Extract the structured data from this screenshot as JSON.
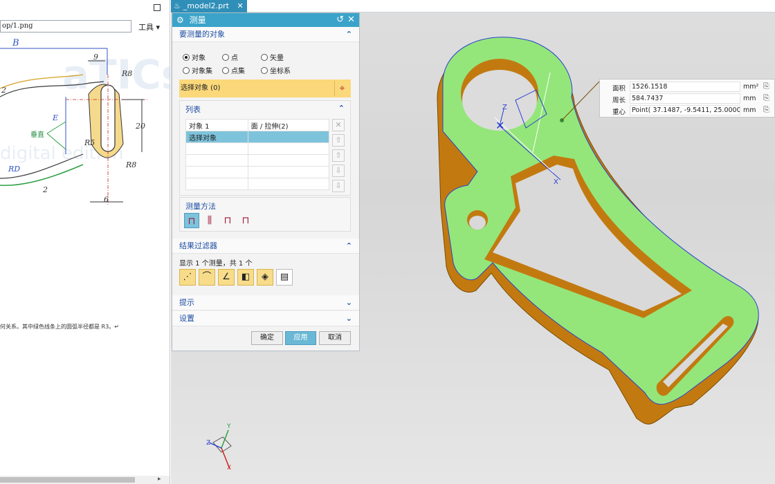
{
  "left_pane": {
    "path": "op/1.png",
    "tools_menu": "工具 ▾",
    "drawing": {
      "label_B": "B",
      "dim_9": "9",
      "dim_R8_top": "R8",
      "dim_20": "20",
      "dim_R8_bottom": "R8",
      "dim_6": "6",
      "label_E": "E",
      "label_perp": "垂直",
      "label_R5": "R5",
      "label_RD": "RD",
      "dim_2": "2",
      "dim_2b": "2",
      "watermark": "digital edition"
    },
    "note": "何关系。其中绿色线条上的圆弧半径都是 R3。↵"
  },
  "file_tab": {
    "icon": "part-icon",
    "label": "_model2.prt",
    "close": "✕"
  },
  "dialog": {
    "title": "测量",
    "title_icon": "gear-icon",
    "reset": "↺",
    "close": "✕",
    "section_objects": "要测量的对象",
    "radio": {
      "object": "对象",
      "point": "点",
      "vector": "矢量",
      "object_set": "对象集",
      "point_set": "点集",
      "csys": "坐标系"
    },
    "select_label": "选择对象 (0)",
    "list_title": "列表",
    "list_rows": [
      {
        "name": "对象 1",
        "type": "面 / 拉伸(2)"
      },
      {
        "name": "选择对象",
        "type": ""
      }
    ],
    "method_title": "测量方法",
    "section_filter": "结果过滤器",
    "filter_count": "显示 1 个测量，共 1 个",
    "section_hint": "提示",
    "section_settings": "设置",
    "btn_ok": "确定",
    "btn_apply": "应用",
    "btn_cancel": "取消"
  },
  "callout": {
    "rows": [
      {
        "label": "面积",
        "value": "1526.1518",
        "unit": "mm²"
      },
      {
        "label": "周长",
        "value": "584.7437",
        "unit": "mm"
      },
      {
        "label": "重心",
        "value": "Point( 37.1487, -9.5411, 25.0000)",
        "unit": "mm"
      }
    ]
  },
  "axes": {
    "x": "X",
    "y": "Y",
    "z": "Z"
  },
  "colors": {
    "face": "#94e67a",
    "wall": "#c27a10",
    "dialog_title": "#3ba3c9",
    "select_bar": "#fbd87a"
  }
}
